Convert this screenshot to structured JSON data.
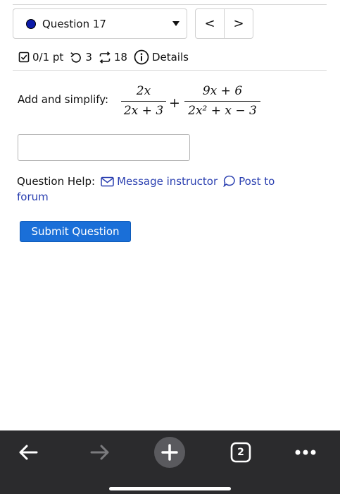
{
  "question": {
    "label": "Question 17",
    "dot_color": "#0b1aa8",
    "prev_label": "<",
    "next_label": ">"
  },
  "stats": {
    "score": "0/1 pt",
    "attempts": "3",
    "retries": "18",
    "details": "Details"
  },
  "problem": {
    "prompt": "Add and simplify:",
    "frac1": {
      "num": "2x",
      "den": "2x + 3"
    },
    "operator": "+",
    "frac2": {
      "num": "9x + 6",
      "den": "2x² + x − 3"
    }
  },
  "answer": {
    "value": ""
  },
  "help": {
    "label": "Question Help:",
    "message_link": "Message instructor",
    "forum_link_1": "Post to",
    "forum_link_2": "forum"
  },
  "submit_label": "Submit Question",
  "browser_bar": {
    "tab_count": "2",
    "icons": [
      "back-arrow-icon",
      "forward-arrow-icon",
      "new-tab-plus-icon",
      "tabs-icon",
      "more-dots-icon"
    ]
  },
  "colors": {
    "accent": "#1a6fd8",
    "link": "#2a3fb0",
    "bar": "#2b2b2d"
  }
}
